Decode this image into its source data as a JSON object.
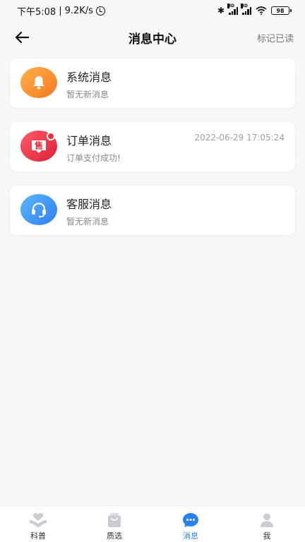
{
  "status_bar": {
    "time": "下午5:08",
    "separator": "|",
    "speed": "9.2K/s",
    "bluetooth": "✱",
    "hd1": "HD",
    "hd2": "HD",
    "battery": "98"
  },
  "nav": {
    "title": "消息中心",
    "mark_read": "标记已读"
  },
  "messages": [
    {
      "title": "系统消息",
      "subtitle": "暂无新消息",
      "time": "",
      "icon": "bell-icon",
      "color": "#f7902f",
      "unread": false
    },
    {
      "title": "订单消息",
      "subtitle": "订单支付成功!",
      "time": "2022-06-29 17:05:24",
      "icon": "sale-icon",
      "color": "#ef3347",
      "unread": true,
      "icon_text": "售"
    },
    {
      "title": "客服消息",
      "subtitle": "暂无新消息",
      "time": "",
      "icon": "headset-icon",
      "color": "#3d8ff5",
      "unread": false
    }
  ],
  "tabs": [
    {
      "label": "科普",
      "icon": "heart-hands-icon",
      "active": false
    },
    {
      "label": "质选",
      "icon": "shopping-bag-icon",
      "active": false
    },
    {
      "label": "消息",
      "icon": "chat-bubble-icon",
      "active": true
    },
    {
      "label": "我",
      "icon": "person-icon",
      "active": false
    }
  ],
  "colors": {
    "accent": "#2b80ef",
    "inactive_icon": "#c8ccd4",
    "unread_dot": "#e8303f"
  }
}
